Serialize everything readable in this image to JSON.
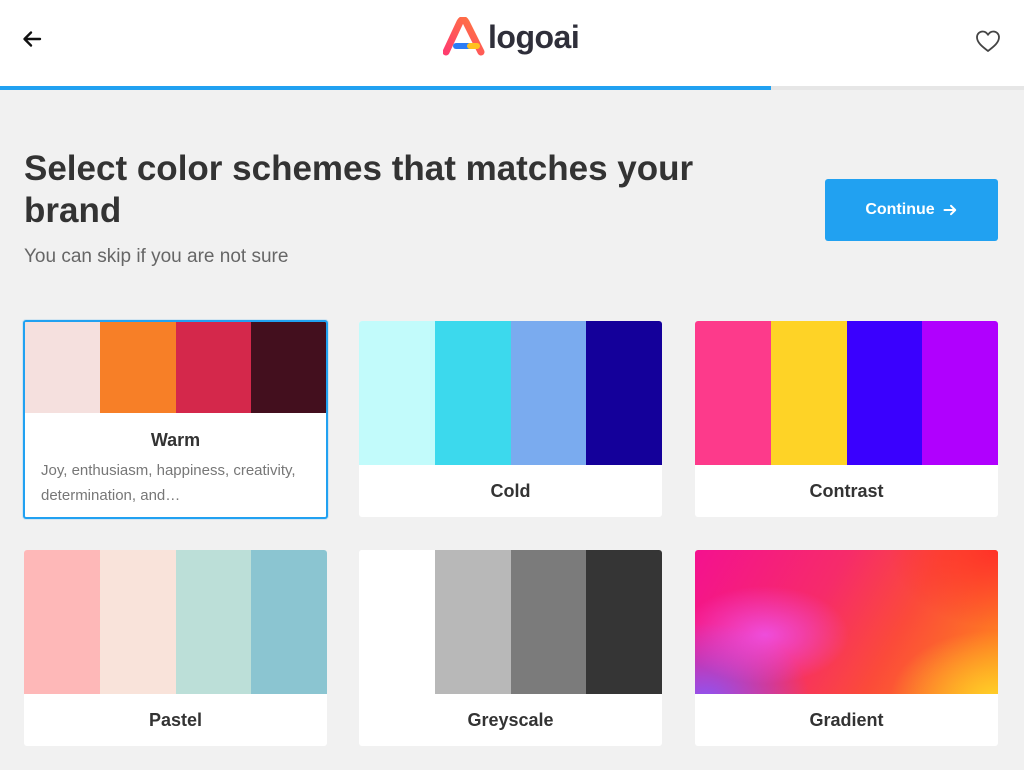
{
  "header": {
    "logo_text": "logoai",
    "back_icon": "arrow-left-icon",
    "favorite_icon": "heart-outline-icon"
  },
  "progress": {
    "fraction": 0.753
  },
  "page": {
    "title": "Select color schemes that matches your brand",
    "subtitle": "You can skip if you are not sure",
    "continue_label": "Continue",
    "continue_icon": "arrow-right-icon"
  },
  "schemes": [
    {
      "name": "Warm",
      "selected": true,
      "description": "Joy, enthusiasm, happiness, creativity, determination, and…",
      "colors": [
        "#f5e0de",
        "#f77f27",
        "#d4284b",
        "#430f1e"
      ]
    },
    {
      "name": "Cold",
      "selected": false,
      "colors": [
        "#c2fbfb",
        "#3cd9ed",
        "#7aabef",
        "#14009a"
      ]
    },
    {
      "name": "Contrast",
      "selected": false,
      "colors": [
        "#fd3a8b",
        "#fed326",
        "#3a00fe",
        "#b000fe"
      ]
    },
    {
      "name": "Pastel",
      "selected": false,
      "colors": [
        "#feb8b8",
        "#f9e3da",
        "#bcdfd8",
        "#8bc5d1"
      ]
    },
    {
      "name": "Greyscale",
      "selected": false,
      "colors": [
        "#ffffff",
        "#b8b8b8",
        "#7b7b7b",
        "#353535"
      ]
    },
    {
      "name": "Gradient",
      "selected": false,
      "colors": [
        "#f4118f",
        "#fb4a3a",
        "#ffd028",
        "#8a5cff"
      ]
    }
  ],
  "colors": {
    "accent": "#21a1f1"
  }
}
